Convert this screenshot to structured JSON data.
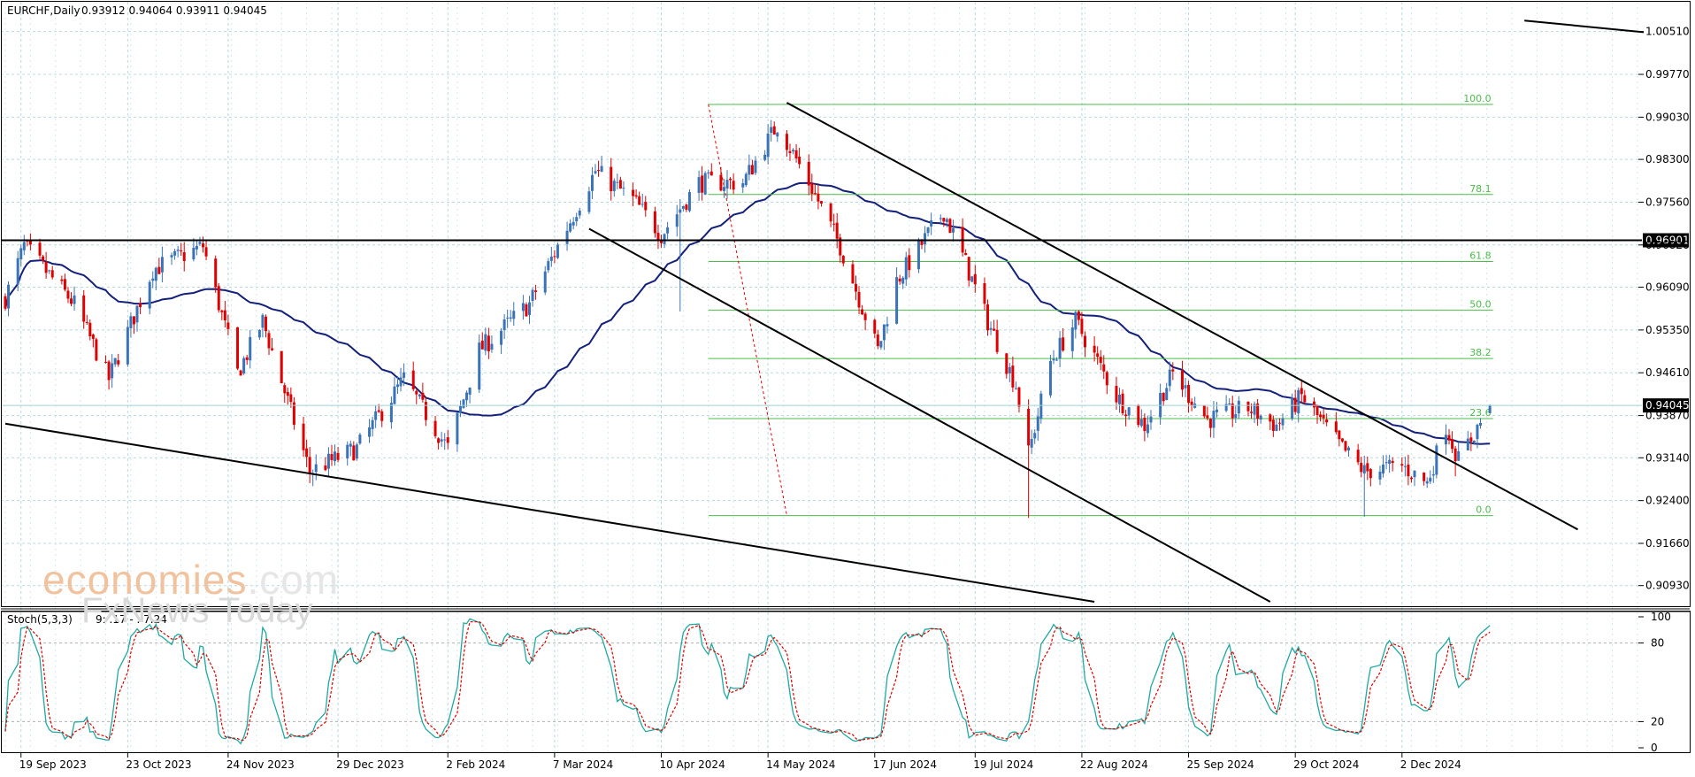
{
  "header": {
    "symbol": "EURCHF,Daily",
    "ohlc": "0.93912 0.94064 0.93911 0.94045"
  },
  "watermark": {
    "brand": "economies",
    "suffix": ".com",
    "line2": "FxNews Today"
  },
  "colors": {
    "bull": "#3a73b8",
    "bear": "#e00000",
    "ma": "#14207a",
    "fib": "#4bbd4b",
    "grid": "#b8d8e0",
    "trend": "#000000",
    "stoch_main": "#1fa9a0",
    "stoch_signal": "#e00000",
    "price_tag_bg": "#000000",
    "price_tag_fg": "#ffffff"
  },
  "chart_data": [
    {
      "type": "candlestick",
      "title": "EURCHF,Daily",
      "ylim": [
        0.9065,
        1.0075
      ],
      "y_ticks": [
        "1.00510",
        "0.99770",
        "0.99030",
        "0.98300",
        "0.97560",
        "0.96820",
        "0.96090",
        "0.95350",
        "0.94610",
        "0.93870",
        "0.93140",
        "0.92400",
        "0.91660",
        "0.90930"
      ],
      "x_ticks": [
        "19 Sep 2023",
        "23 Oct 2023",
        "24 Nov 2023",
        "29 Dec 2023",
        "2 Feb 2024",
        "7 Mar 2024",
        "10 Apr 2024",
        "14 May 2024",
        "17 Jun 2024",
        "19 Jul 2024",
        "22 Aug 2024",
        "25 Sep 2024",
        "29 Oct 2024",
        "2 Dec 2024"
      ],
      "anchors": [
        {
          "date": "2023-09-14",
          "close": 0.959
        },
        {
          "date": "2023-09-20",
          "close": 0.968
        },
        {
          "date": "2023-10-06",
          "close": 0.958
        },
        {
          "date": "2023-10-17",
          "close": 0.945
        },
        {
          "date": "2023-10-31",
          "close": 0.964
        },
        {
          "date": "2023-11-16",
          "close": 0.968
        },
        {
          "date": "2023-11-27",
          "close": 0.946
        },
        {
          "date": "2023-12-05",
          "close": 0.955
        },
        {
          "date": "2023-12-20",
          "close": 0.929
        },
        {
          "date": "2024-01-04",
          "close": 0.933
        },
        {
          "date": "2024-01-19",
          "close": 0.945
        },
        {
          "date": "2024-02-02",
          "close": 0.933
        },
        {
          "date": "2024-02-12",
          "close": 0.95
        },
        {
          "date": "2024-02-28",
          "close": 0.958
        },
        {
          "date": "2024-03-08",
          "close": 0.968
        },
        {
          "date": "2024-03-20",
          "close": 0.981
        },
        {
          "date": "2024-04-01",
          "close": 0.976
        },
        {
          "date": "2024-04-10",
          "close": 0.97
        },
        {
          "date": "2024-04-22",
          "close": 0.979
        },
        {
          "date": "2024-05-06",
          "close": 0.979
        },
        {
          "date": "2024-05-17",
          "close": 0.989
        },
        {
          "date": "2024-05-28",
          "close": 0.978
        },
        {
          "date": "2024-06-06",
          "close": 0.968
        },
        {
          "date": "2024-06-18",
          "close": 0.95
        },
        {
          "date": "2024-06-24",
          "close": 0.962
        },
        {
          "date": "2024-07-09",
          "close": 0.974
        },
        {
          "date": "2024-07-16",
          "close": 0.965
        },
        {
          "date": "2024-07-23",
          "close": 0.955
        },
        {
          "date": "2024-08-01",
          "close": 0.944
        },
        {
          "date": "2024-08-05",
          "close": 0.932
        },
        {
          "date": "2024-08-12",
          "close": 0.948
        },
        {
          "date": "2024-08-20",
          "close": 0.955
        },
        {
          "date": "2024-09-02",
          "close": 0.942
        },
        {
          "date": "2024-09-11",
          "close": 0.937
        },
        {
          "date": "2024-09-20",
          "close": 0.946
        },
        {
          "date": "2024-10-01",
          "close": 0.938
        },
        {
          "date": "2024-10-14",
          "close": 0.94
        },
        {
          "date": "2024-10-23",
          "close": 0.937
        },
        {
          "date": "2024-10-31",
          "close": 0.942
        },
        {
          "date": "2024-11-13",
          "close": 0.933
        },
        {
          "date": "2024-11-20",
          "close": 0.929
        },
        {
          "date": "2024-12-02",
          "close": 0.93
        },
        {
          "date": "2024-12-10",
          "close": 0.927
        },
        {
          "date": "2024-12-16",
          "close": 0.937
        },
        {
          "date": "2024-12-20",
          "close": 0.931
        },
        {
          "date": "2024-12-30",
          "close": 0.9404
        }
      ],
      "last_price": "0.94045",
      "marked_level": {
        "label": "0.96901",
        "value": 0.96901
      },
      "fibonacci": {
        "from_value": 0.9214,
        "to_value": 0.9925,
        "start_date": "2024-04-25",
        "end_date": "2024-12-31",
        "levels": [
          {
            "label": "100.0",
            "ratio": 1.0
          },
          {
            "label": "78.1",
            "ratio": 0.781
          },
          {
            "label": "61.8",
            "ratio": 0.618
          },
          {
            "label": "50.0",
            "ratio": 0.5
          },
          {
            "label": "38.2",
            "ratio": 0.382
          },
          {
            "label": "23.6",
            "ratio": 0.236
          },
          {
            "label": "0.0",
            "ratio": 0.0
          }
        ]
      },
      "trendlines": [
        {
          "name": "channel-upper",
          "from": {
            "date": "2024-05-20",
            "value": 0.9928
          },
          "to": {
            "date": "2025-01-27",
            "value": 0.919
          }
        },
        {
          "name": "channel-lower",
          "from": {
            "date": "2024-03-18",
            "value": 0.971
          },
          "to": {
            "date": "2024-10-21",
            "value": 0.9065
          }
        },
        {
          "name": "long-support",
          "from": {
            "date": "2023-09-14",
            "value": 0.9373
          },
          "to": {
            "date": "2024-08-26",
            "value": 0.9065
          }
        },
        {
          "name": "top-right",
          "from": {
            "date": "2025-01-10",
            "value": 1.007
          },
          "to": {
            "date": "2025-02-17",
            "value": 1.005
          }
        }
      ],
      "fib_diagonal": {
        "from": {
          "date": "2024-04-25",
          "value": 0.9925
        },
        "to": {
          "date": "2024-05-20",
          "value": 0.9214
        }
      },
      "moving_average": {
        "period": 50
      }
    },
    {
      "type": "line",
      "title": "Stoch(5,3,3)",
      "header_values": "9: .17 - . 7.24",
      "ylim": [
        0,
        100
      ],
      "y_ticks": [
        "100",
        "80",
        "20",
        "0"
      ],
      "series": [
        {
          "name": "Main",
          "from_price": true
        },
        {
          "name": "Signal",
          "smoothing": 3
        }
      ]
    }
  ]
}
